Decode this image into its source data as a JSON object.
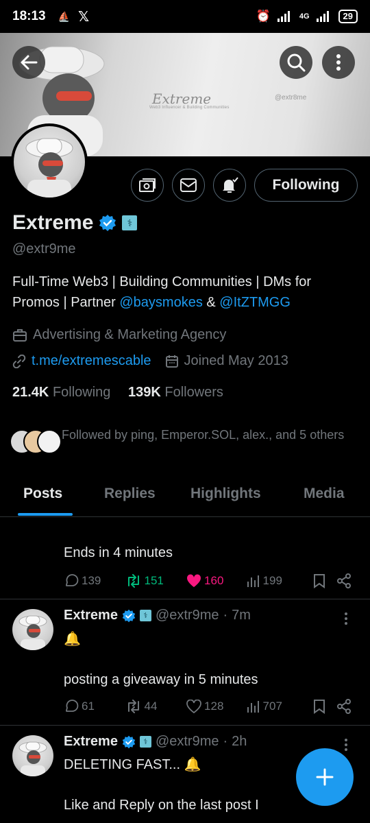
{
  "status_bar": {
    "time": "18:13",
    "network": "4G",
    "battery": "29"
  },
  "banner": {
    "logo_text": "Extreme",
    "logo_sub": "Web3 Influencer & Building Communities",
    "handle_text": "@extr8me"
  },
  "profile": {
    "name": "Extreme",
    "handle": "@extr9me",
    "follow_button": "Following",
    "bio_text_1": "Full-Time Web3 | Building Communities | DMs for Promos | Partner ",
    "bio_link_1": "@baysmokes",
    "bio_sep": " & ",
    "bio_link_2": "@ItZTMGG",
    "category": "Advertising & Marketing Agency",
    "website": "t.me/extremescable",
    "joined": "Joined May 2013",
    "following_count": "21.4K",
    "following_label": "Following",
    "followers_count": "139K",
    "followers_label": "Followers",
    "followed_by": "Followed by ping, Emperor.SOL, alex., and 5 others"
  },
  "tabs": [
    "Posts",
    "Replies",
    "Highlights",
    "Media"
  ],
  "posts": [
    {
      "text": "Ends in 4 minutes",
      "replies": "139",
      "reposts": "151",
      "likes": "160",
      "views": "199"
    },
    {
      "name": "Extreme",
      "handle": "@extr9me",
      "time": "7m",
      "line1": "🔔",
      "line2": "posting a giveaway in 5 minutes",
      "replies": "61",
      "reposts": "44",
      "likes": "128",
      "views": "707"
    },
    {
      "name": "Extreme",
      "handle": "@extr9me",
      "time": "2h",
      "line1": "DELETING FAST... 🔔",
      "line2": "Like and Reply on the last post I"
    }
  ],
  "colors": {
    "accent": "#1d9bf0",
    "repost_active": "#00ba7c",
    "like_active": "#f91880",
    "muted": "#71767b"
  }
}
